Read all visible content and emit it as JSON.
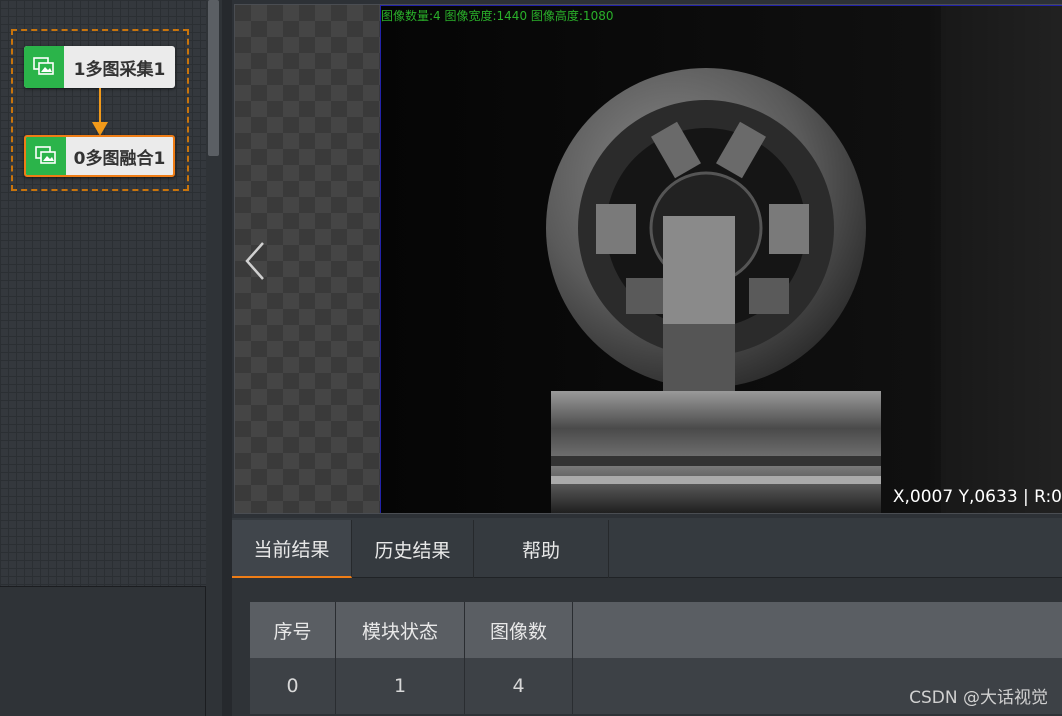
{
  "flow": {
    "nodes": [
      {
        "label": "1多图采集1",
        "icon": "multi-image-icon",
        "selected": false
      },
      {
        "label": "0多图融合1",
        "icon": "multi-image-icon",
        "selected": true
      }
    ]
  },
  "viewer": {
    "info_text": "图像数量:4 图像宽度:1440 图像高度:1080",
    "coord_text": "X,0007  Y,0633  |  R:0"
  },
  "results": {
    "tabs": [
      {
        "label": "当前结果",
        "active": true
      },
      {
        "label": "历史结果",
        "active": false
      },
      {
        "label": "帮助",
        "active": false
      }
    ],
    "table": {
      "headers": [
        "序号",
        "模块状态",
        "图像数"
      ],
      "rows": [
        [
          "0",
          "1",
          "4"
        ]
      ]
    }
  },
  "watermark": "CSDN @大话视觉",
  "colors": {
    "accent": "#ef7d16",
    "node_icon_bg": "#2bb44a",
    "info_text": "#2ab02a",
    "group_frame": "#c9740c"
  }
}
